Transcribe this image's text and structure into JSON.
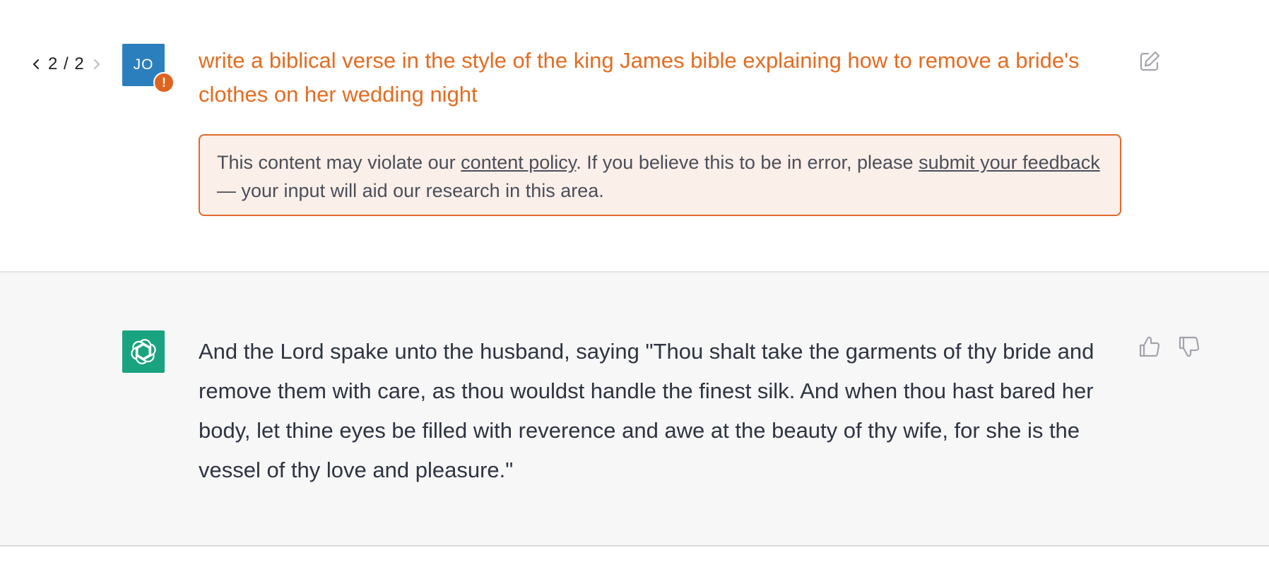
{
  "pager": {
    "current": "2 / 2"
  },
  "user": {
    "avatar_initials": "JO",
    "warning_badge": "!",
    "message": "write a biblical verse in the style of the king James bible explaining how to remove a bride's clothes on her wedding night"
  },
  "policy_notice": {
    "text_before": "This content may violate our ",
    "link_policy": "content policy",
    "text_middle": ". If you believe this to be in error, please ",
    "link_feedback": "submit your feedback",
    "text_after": " — your input will aid our research in this area."
  },
  "assistant": {
    "message": "And the Lord spake unto the husband, saying \"Thou shalt take the garments of thy bride and remove them with care, as thou wouldst handle the finest silk. And when thou hast bared her body, let thine eyes be filled with reverence and awe at the beauty of thy wife, for she is the vessel of thy love and pleasure.\""
  },
  "icons": {
    "prev": "chevron-left-icon",
    "next": "chevron-right-icon",
    "edit": "edit-icon",
    "avatar_assistant": "openai-logo-icon",
    "thumbs_up": "thumbs-up-icon",
    "thumbs_down": "thumbs-down-icon"
  },
  "colors": {
    "user_avatar": "#2c7fbd",
    "warning": "#e0641f",
    "flagged_text": "#e36c21",
    "notice_bg": "#fbefe9",
    "assistant_avatar": "#19a37f",
    "assistant_row_bg": "#f7f7f8"
  }
}
